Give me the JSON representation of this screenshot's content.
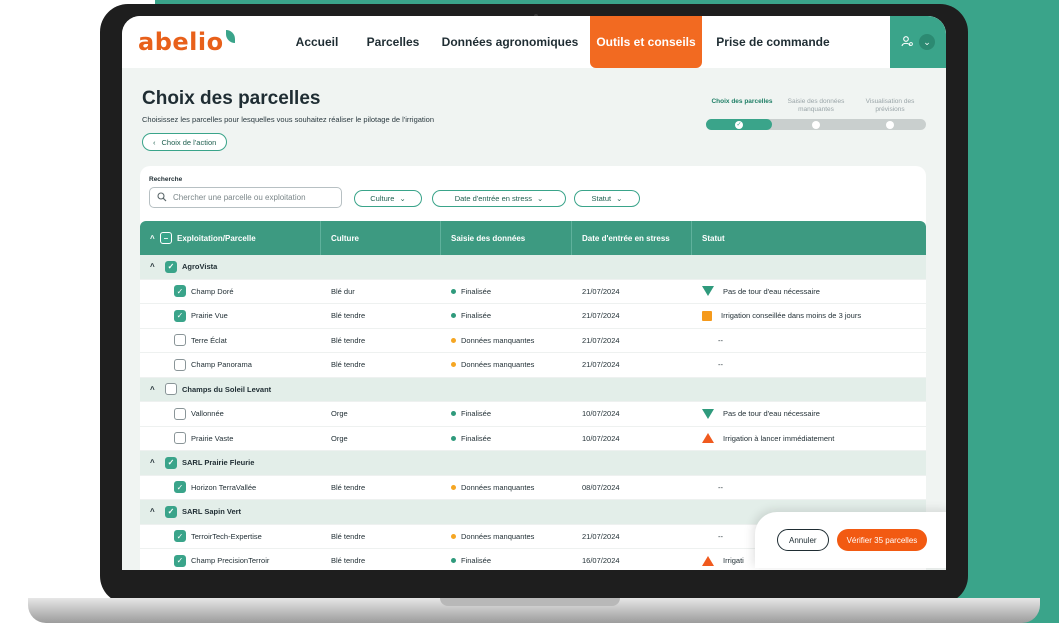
{
  "brand": {
    "logo": "abelio",
    "primary": "#3aa48a",
    "accent": "#f26a21"
  },
  "nav": {
    "items": [
      "Accueil",
      "Parcelles",
      "Données agronomiques",
      "Outils et conseils",
      "Prise de commande"
    ],
    "active": "Outils et conseils",
    "user_icon": "user-settings-icon"
  },
  "header": {
    "title": "Choix des parcelles",
    "subtitle": "Choisissez les parcelles pour lesquelles vous souhaitez réaliser le pilotage de l'irrigation",
    "back_button": "Choix de l'action"
  },
  "stepper": {
    "steps": [
      "Choix des parcelles",
      "Saisie des données manquantes",
      "Visualisation des prévisions"
    ],
    "current_step": 1
  },
  "search": {
    "label": "Recherche",
    "placeholder": "Chercher une parcelle ou exploitation"
  },
  "filters": [
    "Culture",
    "Date d'entrée en stress",
    "Statut"
  ],
  "table": {
    "headers": [
      "Exploitation/Parcelle",
      "Culture",
      "Saisie des données",
      "Date d'entrée en stress",
      "Statut"
    ],
    "rows": [
      {
        "type": "group",
        "name": "AgroVista",
        "checked": true
      },
      {
        "type": "item",
        "name": "Champ Doré",
        "culture": "Blé dur",
        "saisie": "Finalisée",
        "date": "21/07/2024",
        "statut": "Pas de tour d'eau nécessaire",
        "checked": true,
        "saisie_status": "ok",
        "statut_icon": "down"
      },
      {
        "type": "item",
        "name": "Prairie Vue",
        "culture": "Blé tendre",
        "saisie": "Finalisée",
        "date": "21/07/2024",
        "statut": "Irrigation conseillée dans moins de 3 jours",
        "checked": true,
        "saisie_status": "ok",
        "statut_icon": "square"
      },
      {
        "type": "item",
        "name": "Terre Éclat",
        "culture": "Blé tendre",
        "saisie": "Données manquantes",
        "date": "21/07/2024",
        "statut": "--",
        "checked": false,
        "saisie_status": "warn",
        "statut_icon": ""
      },
      {
        "type": "item",
        "name": "Champ Panorama",
        "culture": "Blé tendre",
        "saisie": "Données manquantes",
        "date": "21/07/2024",
        "statut": "--",
        "checked": false,
        "saisie_status": "warn",
        "statut_icon": ""
      },
      {
        "type": "group",
        "name": "Champs du Soleil Levant",
        "checked": false
      },
      {
        "type": "item",
        "name": "Vallonnée",
        "culture": "Orge",
        "saisie": "Finalisée",
        "date": "10/07/2024",
        "statut": "Pas de tour d'eau nécessaire",
        "checked": false,
        "saisie_status": "ok",
        "statut_icon": "down"
      },
      {
        "type": "item",
        "name": "Prairie Vaste",
        "culture": "Orge",
        "saisie": "Finalisée",
        "date": "10/07/2024",
        "statut": "Irrigation à lancer immédiatement",
        "checked": false,
        "saisie_status": "ok",
        "statut_icon": "up"
      },
      {
        "type": "group",
        "name": "SARL Prairie Fleurie",
        "checked": true
      },
      {
        "type": "item",
        "name": "Horizon TerraVallée",
        "culture": "Blé tendre",
        "saisie": "Données manquantes",
        "date": "08/07/2024",
        "statut": "--",
        "checked": true,
        "saisie_status": "warn",
        "statut_icon": ""
      },
      {
        "type": "group",
        "name": "SARL Sapin Vert",
        "checked": true
      },
      {
        "type": "item",
        "name": "TerroirTech-Expertise",
        "culture": "Blé tendre",
        "saisie": "Données manquantes",
        "date": "21/07/2024",
        "statut": "--",
        "checked": true,
        "saisie_status": "warn",
        "statut_icon": ""
      },
      {
        "type": "item",
        "name": "Champ PrecisionTerroir",
        "culture": "Blé tendre",
        "saisie": "Finalisée",
        "date": "16/07/2024",
        "statut": "Irrigati",
        "checked": true,
        "saisie_status": "ok",
        "statut_icon": "up"
      }
    ],
    "status_colors": {
      "ok": "#2f9a7c",
      "warn": "#f5a623"
    }
  },
  "actions": {
    "cancel": "Annuler",
    "verify": "Vérifier 35 parcelles"
  }
}
